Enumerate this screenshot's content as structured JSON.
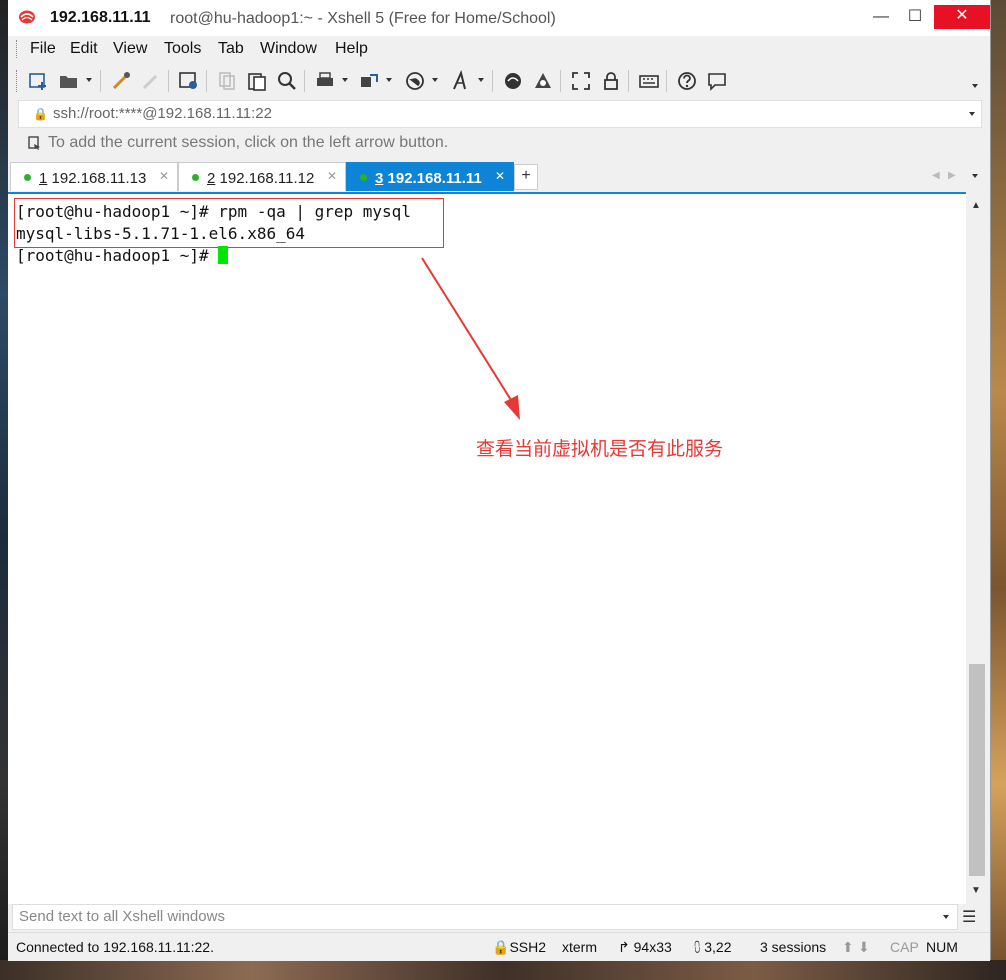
{
  "window": {
    "title_host": "192.168.11.11",
    "title_rest": "root@hu-hadoop1:~ - Xshell 5 (Free for Home/School)",
    "minimize": "—",
    "maximize": "☐",
    "close": "✕"
  },
  "menu": [
    "File",
    "Edit",
    "View",
    "Tools",
    "Tab",
    "Window",
    "Help"
  ],
  "address": {
    "value": "ssh://root:****@192.168.11.11:22"
  },
  "hint": "To add the current session, click on the left arrow button.",
  "tabs": [
    {
      "num": "1",
      "label": "192.168.11.13",
      "active": false
    },
    {
      "num": "2",
      "label": "192.168.11.12",
      "active": false
    },
    {
      "num": "3",
      "label": "192.168.11.11",
      "active": true
    }
  ],
  "tab_add": "+",
  "terminal": {
    "lines": [
      "[root@hu-hadoop1 ~]# rpm -qa | grep mysql",
      "mysql-libs-5.1.71-1.el6.x86_64",
      "[root@hu-hadoop1 ~]# "
    ],
    "annotation": "查看当前虚拟机是否有此服务"
  },
  "send": {
    "placeholder": "Send text to all Xshell windows"
  },
  "status": {
    "connected": "Connected to 192.168.11.11:22.",
    "protocol": "SSH2",
    "term": "xterm",
    "size": "94x33",
    "cursor": "3,22",
    "sessions": "3 sessions",
    "cap": "CAP",
    "num": "NUM"
  },
  "colors": {
    "accent": "#0d84d6",
    "annotation": "#e53935",
    "cursor": "#00e600"
  }
}
